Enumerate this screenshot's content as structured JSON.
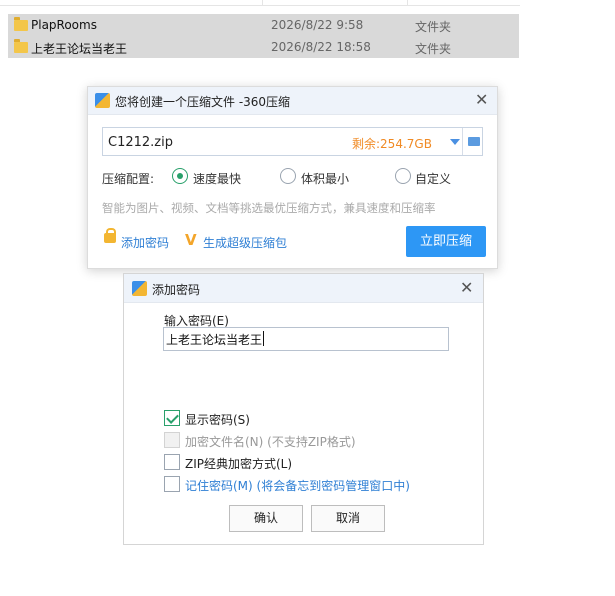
{
  "explorer": {
    "files": [
      {
        "name": "PlapRooms",
        "date": "2026/8/22 9:58",
        "type": "文件夹"
      },
      {
        "name": "上老王论坛当老王",
        "date": "2026/8/22 18:58",
        "type": "文件夹"
      }
    ]
  },
  "compress_dialog": {
    "title": "您将创建一个压缩文件 -360压缩",
    "path_value": "C1212.zip",
    "free_space": "剩余:254.7GB",
    "config_label": "压缩配置:",
    "options": [
      "速度最快",
      "体积最小",
      "自定义"
    ],
    "selected_option": "速度最快",
    "hint": "智能为图片、视频、文档等挑选最优压缩方式，兼具速度和压缩率",
    "add_password": "添加密码",
    "super_pack": "生成超级压缩包",
    "compress_now": "立即压缩"
  },
  "password_dialog": {
    "title": "添加密码",
    "input_label": "输入密码(E)",
    "password_value": "上老王论坛当老王",
    "checkboxes": [
      {
        "label": "显示密码(S)",
        "checked": true,
        "disabled": false
      },
      {
        "label": "加密文件名(N) (不支持ZIP格式)",
        "checked": false,
        "disabled": true
      },
      {
        "label": "ZIP经典加密方式(L)",
        "checked": false,
        "disabled": false
      },
      {
        "label": "记住密码(M) (将会备忘到密码管理窗口中)",
        "checked": false,
        "disabled": false
      }
    ],
    "ok": "确认",
    "cancel": "取消"
  },
  "colors": {
    "accent_blue": "#2d97f5",
    "radio_green": "#29a06b",
    "free_space_orange": "#f08a24"
  }
}
